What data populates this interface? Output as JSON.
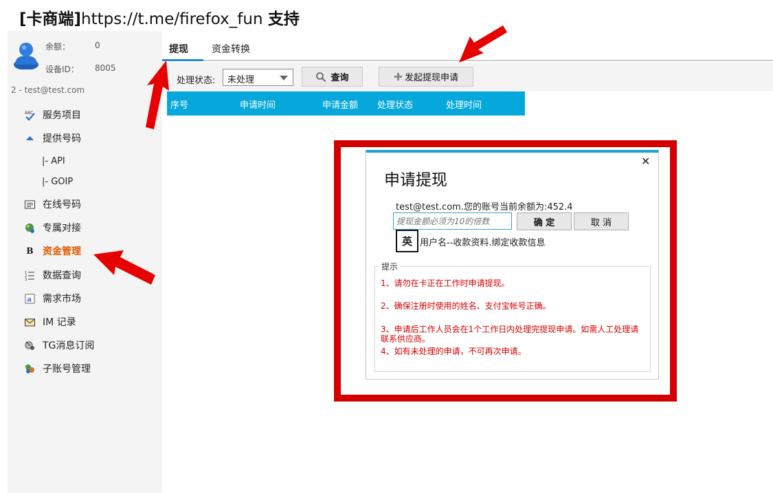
{
  "title": {
    "part1": "[卡商端]",
    "part2": "https://t.me/firefox_fun ",
    "part3": "支持"
  },
  "sidebar": {
    "balance_label": "余额：",
    "balance_value": "0",
    "device_label": "设备ID：",
    "device_value": "8005",
    "account": "2 - test@test.com",
    "items": [
      {
        "label": "服务项目",
        "icon": "abc-check-icon"
      },
      {
        "label": "提供号码",
        "icon": "triangle-up-icon"
      },
      {
        "label": "|-  API",
        "icon": ""
      },
      {
        "label": "|-  GOIP",
        "icon": ""
      },
      {
        "label": "在线号码",
        "icon": "list-card-icon"
      },
      {
        "label": "专属对接",
        "icon": "globe-people-icon"
      },
      {
        "label": "资金管理",
        "icon": "bold-b-icon"
      },
      {
        "label": "数据查询",
        "icon": "numbered-list-icon"
      },
      {
        "label": "需求市场",
        "icon": "page-a-icon"
      },
      {
        "label": "IM 记录",
        "icon": "envelope-icon"
      },
      {
        "label": "TG消息订阅",
        "icon": "satellite-icon"
      },
      {
        "label": "子账号管理",
        "icon": "users-icon"
      }
    ],
    "active_item": "资金管理"
  },
  "tabs": [
    {
      "label": "提现"
    },
    {
      "label": "资金转换"
    }
  ],
  "toolbar": {
    "status_label": "处理状态:",
    "status_value": "未处理",
    "query_button": "查询",
    "apply_button": "发起提现申请"
  },
  "table": {
    "columns": [
      "序号",
      "申请时间",
      "申请金额",
      "处理状态",
      "处理时间"
    ]
  },
  "dialog": {
    "title": "申请提现",
    "message": "test@test.com.您的账号当前余额为:452.4",
    "input_placeholder": "提现金额必须为10的倍数",
    "ok_button": "确 定",
    "cancel_button": "取 消",
    "ime_indicator": "英",
    "info": "用户名--收款资料.绑定收款信息",
    "tips_title": "提示",
    "tips": [
      "1、请勿在卡正在工作时申请提现。",
      "2、确保注册时使用的姓名、支付宝帐号正确。",
      "3、申请后工作人员会在1个工作日内处理完提现申请。如需人工处理请联系供应商。",
      "4、如有未处理的申请，不可再次申请。"
    ]
  },
  "colors": {
    "accent": "#06a8dc",
    "highlight": "#d40000",
    "active_nav": "#e05a00",
    "tip_text": "#d60000"
  }
}
